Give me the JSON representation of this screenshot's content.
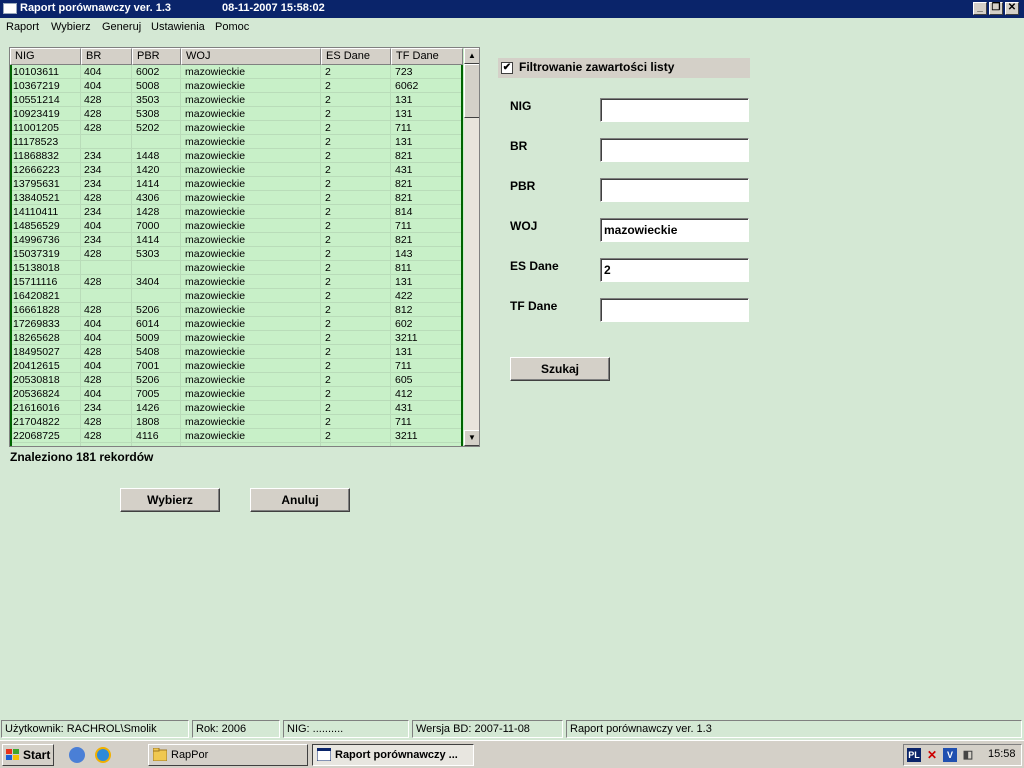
{
  "window": {
    "title": "Raport porównawczy ver. 1.3",
    "datetime": "08-11-2007  15:58:02",
    "minimize": "_",
    "restore": "❐",
    "close": "✕"
  },
  "menu": [
    "Raport",
    "Wybierz",
    "Generuj",
    "Ustawienia",
    "Pomoc"
  ],
  "table": {
    "columns": [
      "NIG",
      "BR",
      "PBR",
      "WOJ",
      "ES Dane",
      "TF Dane"
    ],
    "rows": [
      [
        "10103611",
        "404",
        "6002",
        "mazowieckie",
        "2",
        "723"
      ],
      [
        "10367219",
        "404",
        "5008",
        "mazowieckie",
        "2",
        "6062"
      ],
      [
        "10551214",
        "428",
        "3503",
        "mazowieckie",
        "2",
        "131"
      ],
      [
        "10923419",
        "428",
        "5308",
        "mazowieckie",
        "2",
        "131"
      ],
      [
        "11001205",
        "428",
        "5202",
        "mazowieckie",
        "2",
        "711"
      ],
      [
        "11178523",
        "",
        "",
        "mazowieckie",
        "2",
        "131"
      ],
      [
        "11868832",
        "234",
        "1448",
        "mazowieckie",
        "2",
        "821"
      ],
      [
        "12666223",
        "234",
        "1420",
        "mazowieckie",
        "2",
        "431"
      ],
      [
        "13795631",
        "234",
        "1414",
        "mazowieckie",
        "2",
        "821"
      ],
      [
        "13840521",
        "428",
        "4306",
        "mazowieckie",
        "2",
        "821"
      ],
      [
        "14110411",
        "234",
        "1428",
        "mazowieckie",
        "2",
        "814"
      ],
      [
        "14856529",
        "404",
        "7000",
        "mazowieckie",
        "2",
        "711"
      ],
      [
        "14996736",
        "234",
        "1414",
        "mazowieckie",
        "2",
        "821"
      ],
      [
        "15037319",
        "428",
        "5303",
        "mazowieckie",
        "2",
        "143"
      ],
      [
        "15138018",
        "",
        "",
        "mazowieckie",
        "2",
        "811"
      ],
      [
        "15711116",
        "428",
        "3404",
        "mazowieckie",
        "2",
        "131"
      ],
      [
        "16420821",
        "",
        "",
        "mazowieckie",
        "2",
        "422"
      ],
      [
        "16661828",
        "428",
        "5206",
        "mazowieckie",
        "2",
        "812"
      ],
      [
        "17269833",
        "404",
        "6014",
        "mazowieckie",
        "2",
        "602"
      ],
      [
        "18265628",
        "404",
        "5009",
        "mazowieckie",
        "2",
        "3211"
      ],
      [
        "18495027",
        "428",
        "5408",
        "mazowieckie",
        "2",
        "131"
      ],
      [
        "20412615",
        "404",
        "7001",
        "mazowieckie",
        "2",
        "711"
      ],
      [
        "20530818",
        "428",
        "5206",
        "mazowieckie",
        "2",
        "605"
      ],
      [
        "20536824",
        "404",
        "7005",
        "mazowieckie",
        "2",
        "412"
      ],
      [
        "21616016",
        "234",
        "1426",
        "mazowieckie",
        "2",
        "431"
      ],
      [
        "21704822",
        "428",
        "1808",
        "mazowieckie",
        "2",
        "711"
      ],
      [
        "22068725",
        "428",
        "4116",
        "mazowieckie",
        "2",
        "3211"
      ]
    ],
    "found_text": "Znaleziono 181 rekordów"
  },
  "buttons": {
    "select": "Wybierz",
    "cancel": "Anuluj",
    "search": "Szukaj"
  },
  "filter": {
    "checkbox_label": "Filtrowanie zawartości listy",
    "checked_mark": "✔",
    "fields": {
      "nig": {
        "label": "NIG",
        "value": ""
      },
      "br": {
        "label": "BR",
        "value": ""
      },
      "pbr": {
        "label": "PBR",
        "value": ""
      },
      "woj": {
        "label": "WOJ",
        "value": "mazowieckie"
      },
      "es": {
        "label": "ES Dane",
        "value": "2"
      },
      "tf": {
        "label": "TF Dane",
        "value": ""
      }
    }
  },
  "status": {
    "user": "Użytkownik: RACHROL\\Smolik",
    "year": "Rok:  2006",
    "nig": "NIG:  ..........",
    "db": "Wersja BD:  2007-11-08",
    "app": "Raport porównawczy ver. 1.3"
  },
  "taskbar": {
    "start": "Start",
    "task1": "RapPor",
    "task2": "Raport porównawczy ...",
    "lang": "PL",
    "clock": "15:58"
  }
}
